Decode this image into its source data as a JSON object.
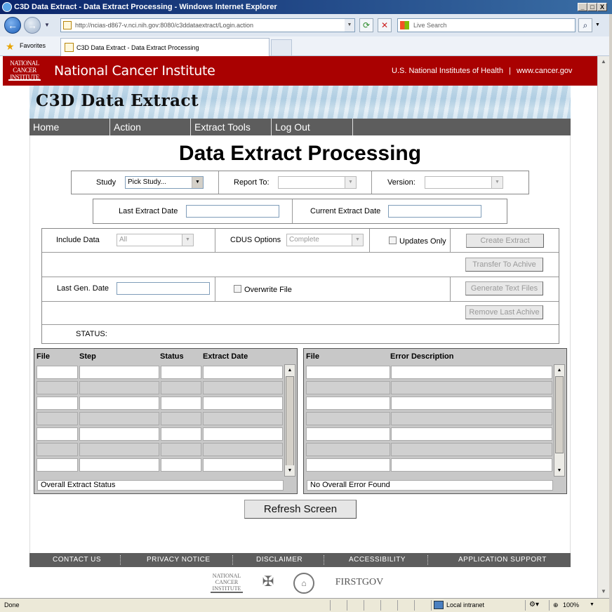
{
  "window": {
    "title": "C3D Data Extract - Data Extract Processing - Windows Internet Explorer",
    "controls": [
      "_",
      "□",
      "X"
    ]
  },
  "browser": {
    "address": "http://ncias-d867-v.nci.nih.gov:8080/c3ddataextract/Login.action",
    "search_placeholder": "Live Search",
    "favorites_label": "Favorites",
    "tab_title": "C3D Data Extract - Data Extract Processing",
    "status_text": "Done",
    "zone": "Local intranet",
    "zoom": "100%"
  },
  "header": {
    "logo_text": "NATIONAL CANCER INSTITUTE",
    "org_name": "National Cancer Institute",
    "nih_link": "U.S. National Institutes of Health",
    "separator": "|",
    "site_link": "www.cancer.gov",
    "app_title": "C3D Data Extract"
  },
  "menu": [
    "Home",
    "Action",
    "Extract Tools",
    "Log Out"
  ],
  "page_title": "Data Extract Processing",
  "filters": {
    "study_label": "Study",
    "study_value": "Pick Study...",
    "report_to_label": "Report To:",
    "report_to_value": "",
    "version_label": "Version:",
    "version_value": "",
    "last_extract_label": "Last Extract Date",
    "current_extract_label": "Current Extract Date"
  },
  "options": {
    "include_data_label": "Include Data",
    "include_data_value": "All",
    "cdus_label": "CDUS Options",
    "cdus_value": "Complete",
    "updates_only_label": "Updates Only",
    "last_gen_label": "Last Gen. Date",
    "overwrite_label": "Overwrite File",
    "status_label": "STATUS:",
    "buttons": {
      "create": "Create Extract",
      "transfer": "Transfer To Achive",
      "generate": "Generate Text Files",
      "remove": "Remove Last Achive"
    }
  },
  "extract_grid": {
    "headers": [
      "File",
      "Step",
      "Status",
      "Extract Date"
    ],
    "overall_status": "Overall Extract Status"
  },
  "error_grid": {
    "headers": [
      "File",
      "Error Description"
    ],
    "overall_status": "No Overall Error Found"
  },
  "refresh_label": "Refresh Screen",
  "footer": {
    "links": [
      "CONTACT US",
      "PRIVACY NOTICE",
      "DISCLAIMER",
      "ACCESSIBILITY",
      "APPLICATION SUPPORT"
    ],
    "logos": [
      "NATIONAL CANCER INSTITUTE",
      "HHS",
      "NATIONAL INSTITUTES OF HEALTH",
      "FIRSTGOV"
    ]
  },
  "colors": {
    "nci_red": "#a90101",
    "menu_gray": "#5d5d5d",
    "grid_gray": "#c8c8c8"
  }
}
